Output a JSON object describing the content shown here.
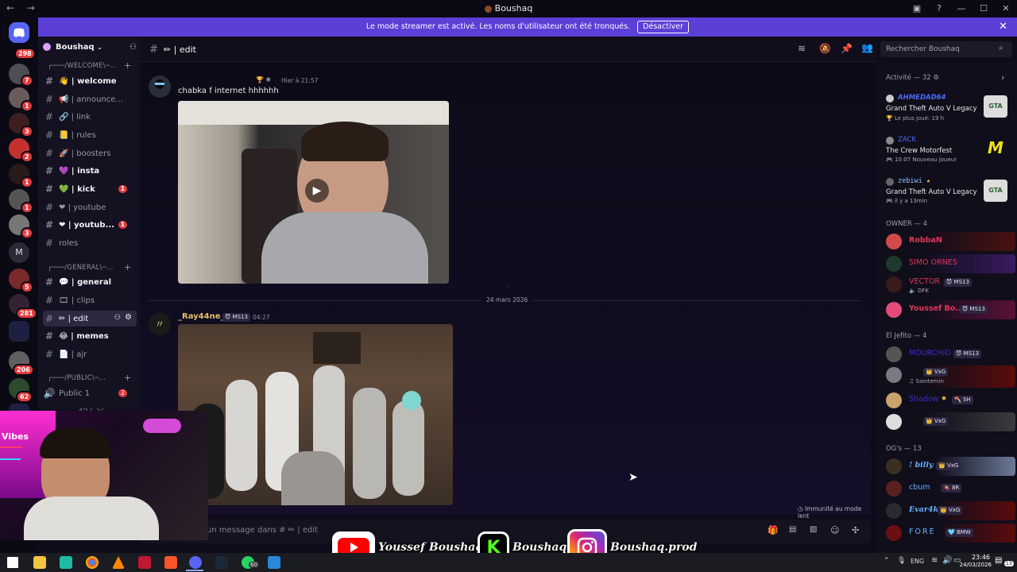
{
  "window": {
    "title": "Boushaq",
    "nav_back": "←",
    "nav_forward": "→",
    "controls": [
      "—",
      "☐",
      "✕"
    ]
  },
  "banner": {
    "text": "Le mode streamer est activé. Les noms d'utilisateur ont été tronqués.",
    "button": "Désactiver"
  },
  "guilds": {
    "badges": [
      "298",
      "7",
      "1",
      "3",
      "2",
      "1",
      "1",
      "3",
      "5",
      "281",
      "206",
      "62"
    ],
    "letter": "M"
  },
  "server": {
    "name": "Boushaq",
    "categories": [
      "┌───/WELCOME\\─...",
      "┌───/GENERAL\\─...",
      "┌───/PUBLIC\\─..."
    ],
    "channels": [
      {
        "icon": "👋",
        "label": "welcome"
      },
      {
        "icon": "📢",
        "label": "announce..."
      },
      {
        "icon": "🔗",
        "label": "link"
      },
      {
        "icon": "📒",
        "label": "rules"
      },
      {
        "icon": "🚀",
        "label": "boosters"
      },
      {
        "icon": "💜",
        "label": "insta"
      },
      {
        "icon": "💚",
        "label": "kick",
        "badge": "1"
      },
      {
        "icon": "❤",
        "label": "youtube"
      },
      {
        "icon": "❤",
        "label": "youtub...",
        "badge": "1"
      },
      {
        "icon": "",
        "label": "roles"
      },
      {
        "icon": "💬",
        "label": "general"
      },
      {
        "icon": "🎞",
        "label": "clips"
      },
      {
        "icon": "✏",
        "label": "edit"
      },
      {
        "icon": "😂",
        "label": "memes"
      },
      {
        "icon": "📄",
        "label": "ajr"
      },
      {
        "icon": "🔊",
        "label": "Public 1",
        "badge": "2"
      },
      {
        "icon": "",
        "label": "4ア̷ㄥ∂ℰ..."
      }
    ]
  },
  "channel_header": {
    "name": "| edit"
  },
  "search": {
    "placeholder": "Rechercher Boushaq"
  },
  "messages": [
    {
      "time": "Hier à 21:57",
      "text": "chabka f internet hhhhhh"
    },
    {
      "author": "_Ray44ne_",
      "tag": "MS13",
      "time": "04:27"
    }
  ],
  "date_divider": "24 mars 2026",
  "immunity_note": "Immunité au mode lent",
  "input": {
    "placeholder": "un message dans # ✏ | edit"
  },
  "members": {
    "activity_header": "Activité — 32",
    "activities": [
      {
        "name": "AHMEDAD64",
        "game": "Grand Theft Auto V Legacy",
        "sub": "Le plus joué: 19 h"
      },
      {
        "name": "ZACK",
        "game": "The Crew Motorfest",
        "sub": "10:07  Nouveau joueur"
      },
      {
        "name": "zebiwi",
        "game": "Grand Theft Auto V Legacy",
        "sub": "il y a 13min"
      }
    ],
    "owner_header": "OWNER — 4",
    "owners": [
      {
        "name": "RobbaN"
      },
      {
        "name": "SIMO ORNES"
      },
      {
        "name": "VECTOR",
        "tag": "MS13",
        "status": "DFK"
      },
      {
        "name": "Youssef Bo...",
        "tag": "MS13"
      }
    ],
    "jefito_header": "El Jefito — 4",
    "jefitos": [
      {
        "name": "MOURCHID",
        "tag": "MS13"
      },
      {
        "name": "",
        "tag": "VxG",
        "status": "Saintemin"
      },
      {
        "name": "Shadow",
        "tag": "SH"
      },
      {
        "name": "",
        "tag": "VxG"
      }
    ],
    "og_header": "OG's — 13",
    "ogs": [
      {
        "name": "! billy",
        "tag": "VxG"
      },
      {
        "name": "cbum",
        "tag": "8R"
      },
      {
        "name": "Evar4k",
        "tag": "VxG"
      },
      {
        "name": "FORE",
        "tag": "BMW"
      }
    ]
  },
  "overlay": {
    "youtube": "Youssef Boushaq",
    "kick": "Boushaq",
    "instagram": "Boushaq.prod",
    "webcam_sign": "Vibes"
  },
  "taskbar": {
    "lang": "ENG",
    "time": "23:46",
    "date": "24/03/2026",
    "notif": "13",
    "whatsapp_badge": "60"
  },
  "colors": {
    "accent": "#5b3fd6",
    "badge": "#e03a3e",
    "owner": "#e0365b",
    "og": "#66b2ff"
  }
}
